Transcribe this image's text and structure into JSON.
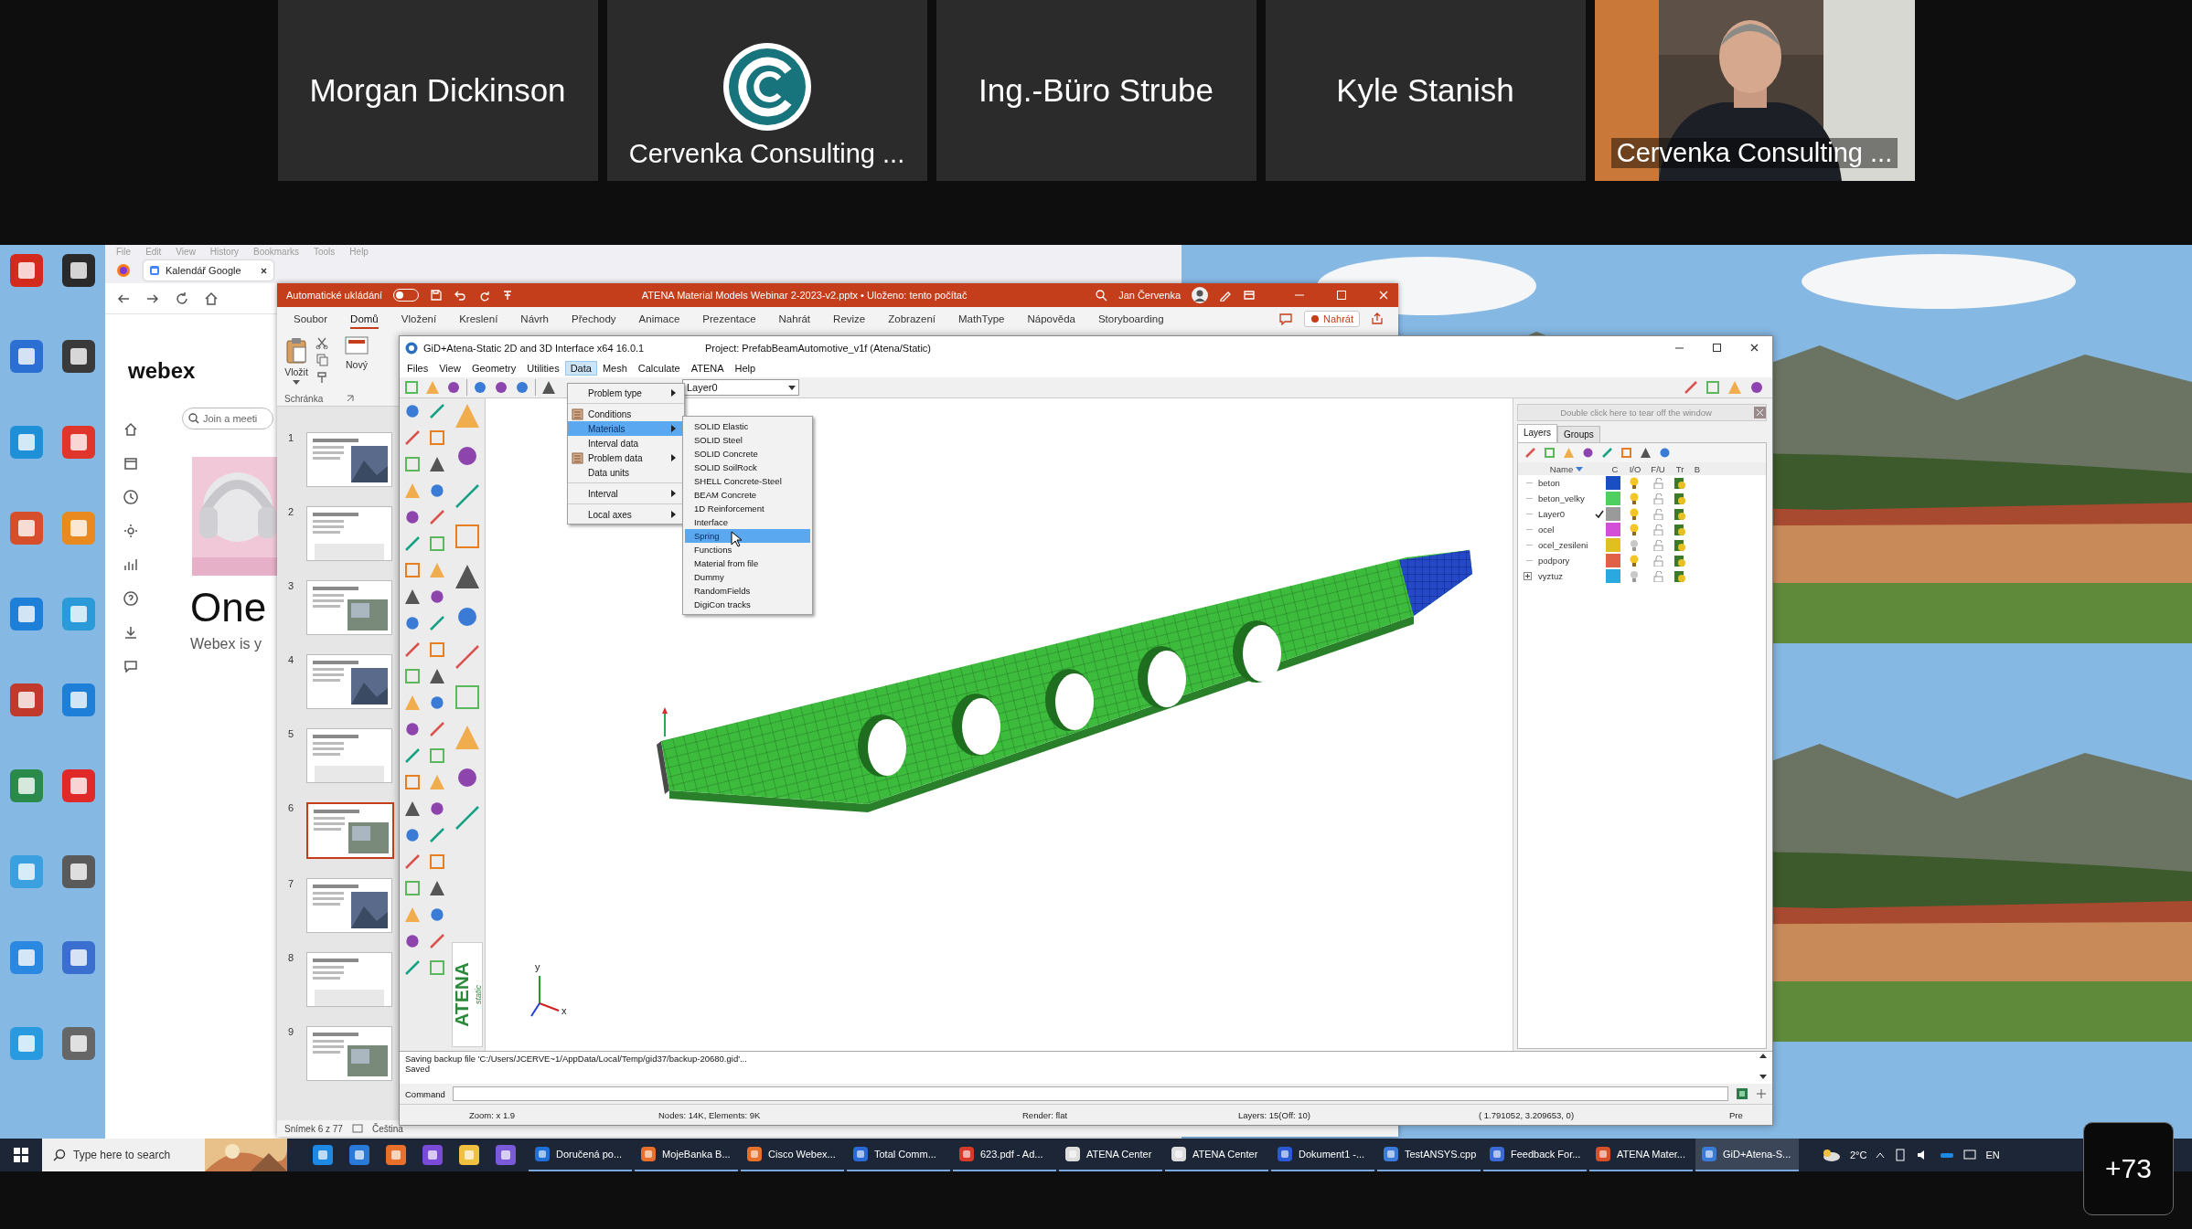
{
  "participants": [
    {
      "name": "Morgan Dickinson",
      "kind": "name"
    },
    {
      "name": "Cervenka Consulting ...",
      "kind": "logo"
    },
    {
      "name": "Ing.-Büro Strube",
      "kind": "name"
    },
    {
      "name": "Kyle Stanish",
      "kind": "name"
    },
    {
      "name": "Cervenka Consulting ...",
      "kind": "video"
    }
  ],
  "hidden_participants": "+73",
  "browser": {
    "menu": [
      "File",
      "Edit",
      "View",
      "History",
      "Bookmarks",
      "Tools",
      "Help"
    ],
    "tab": "Kalendář Google",
    "brand": "webex",
    "search": {
      "placeholder": "Join a meeti"
    },
    "headline": "One",
    "tagline": "Webex is y"
  },
  "powerpoint": {
    "autosave": {
      "label": "Automatické ukládání",
      "on": false
    },
    "title": "ATENA Material Models Webinar 2-2023-v2.pptx • Uloženo: tento počítač",
    "user": "Jan Červenka",
    "tabs": [
      {
        "label": "Soubor",
        "selected": false
      },
      {
        "label": "Domů",
        "selected": true
      },
      {
        "label": "Vložení",
        "selected": false
      },
      {
        "label": "Kreslení",
        "selected": false
      },
      {
        "label": "Návrh",
        "selected": false
      },
      {
        "label": "Přechody",
        "selected": false
      },
      {
        "label": "Animace",
        "selected": false
      },
      {
        "label": "Prezentace",
        "selected": false
      },
      {
        "label": "Nahrát",
        "selected": false
      },
      {
        "label": "Revize",
        "selected": false
      },
      {
        "label": "Zobrazení",
        "selected": false
      },
      {
        "label": "MathType",
        "selected": false
      },
      {
        "label": "Nápověda",
        "selected": false
      },
      {
        "label": "Storyboarding",
        "selected": false
      }
    ],
    "record": "Nahrát",
    "paste": "Vložit",
    "new_slide": "Nový",
    "clipboard_group": "Schránka",
    "slides": [
      {
        "number": "1",
        "selected": false
      },
      {
        "number": "2",
        "selected": false
      },
      {
        "number": "3",
        "selected": false
      },
      {
        "number": "4",
        "selected": false
      },
      {
        "number": "5",
        "selected": false
      },
      {
        "number": "6",
        "selected": true
      },
      {
        "number": "7",
        "selected": false
      },
      {
        "number": "8",
        "selected": false
      },
      {
        "number": "9",
        "selected": false
      }
    ],
    "status": "Snímek 6 z 77",
    "language": "Čeština"
  },
  "gid": {
    "title": "GiD+Atena-Static 2D and 3D Interface x64 16.0.1",
    "project": "Project: PrefabBeamAutomotive_v1f (Atena/Static)",
    "menu": [
      {
        "label": "Files",
        "selected": false
      },
      {
        "label": "View",
        "selected": false
      },
      {
        "label": "Geometry",
        "selected": false
      },
      {
        "label": "Utilities",
        "selected": false
      },
      {
        "label": "Data",
        "selected": true
      },
      {
        "label": "Mesh",
        "selected": false
      },
      {
        "label": "Calculate",
        "selected": false
      },
      {
        "label": "ATENA",
        "selected": false
      },
      {
        "label": "Help",
        "selected": false
      }
    ],
    "layer_field": "Layer0",
    "brand": "ATENA",
    "brand_sub": "static",
    "data_menu": [
      [
        {
          "label": "Problem type",
          "kind": "submenu",
          "icon": false,
          "selected": false
        }
      ],
      [
        {
          "label": "Conditions",
          "kind": "command",
          "icon": true,
          "selected": false
        },
        {
          "label": "Materials",
          "kind": "submenu",
          "icon": false,
          "selected": true
        },
        {
          "label": "Interval data",
          "kind": "command",
          "icon": false,
          "selected": false
        },
        {
          "label": "Problem data",
          "kind": "submenu",
          "icon": true,
          "selected": false
        },
        {
          "label": "Data units",
          "kind": "command",
          "icon": false,
          "selected": false
        }
      ],
      [
        {
          "label": "Interval",
          "kind": "submenu",
          "icon": false,
          "selected": false
        }
      ],
      [
        {
          "label": "Local axes",
          "kind": "submenu",
          "icon": false,
          "selected": false
        }
      ]
    ],
    "materials_menu": [
      {
        "label": "SOLID Elastic",
        "selected": false
      },
      {
        "label": "SOLID Steel",
        "selected": false
      },
      {
        "label": "SOLID Concrete",
        "selected": false
      },
      {
        "label": "SOLID SoilRock",
        "selected": false
      },
      {
        "label": "SHELL Concrete-Steel",
        "selected": false
      },
      {
        "label": "BEAM Concrete",
        "selected": false
      },
      {
        "label": "1D Reinforcement",
        "selected": false
      },
      {
        "label": "Interface",
        "selected": false
      },
      {
        "label": "Spring",
        "selected": true
      },
      {
        "label": "Functions",
        "selected": false
      },
      {
        "label": "Material from file",
        "selected": false
      },
      {
        "label": "Dummy",
        "selected": false
      },
      {
        "label": "RandomFields",
        "selected": false
      },
      {
        "label": "DigiCon tracks",
        "selected": false
      }
    ],
    "layers_panel": {
      "tear_hint": "Double click here to tear off the window",
      "tabs": [
        {
          "label": "Layers",
          "selected": true
        },
        {
          "label": "Groups",
          "selected": false
        }
      ],
      "columns": [
        "Name",
        "C",
        "I/O",
        "F/U",
        "Tr",
        "B"
      ],
      "layers": [
        {
          "name": "beton",
          "color": "#1a4fc4",
          "on": true,
          "current": false,
          "expandable": false
        },
        {
          "name": "beton_velky",
          "color": "#4fcf5f",
          "on": true,
          "current": false,
          "expandable": false
        },
        {
          "name": "Layer0",
          "color": "#9a9a9a",
          "on": true,
          "current": true,
          "expandable": false
        },
        {
          "name": "ocel",
          "color": "#d44fd8",
          "on": true,
          "current": false,
          "expandable": false
        },
        {
          "name": "ocel_zesileni",
          "color": "#e0c020",
          "on": false,
          "current": false,
          "expandable": false
        },
        {
          "name": "podpory",
          "color": "#e06048",
          "on": true,
          "current": false,
          "expandable": false
        },
        {
          "name": "vyztuz",
          "color": "#2aa8e0",
          "on": false,
          "current": false,
          "expandable": true
        }
      ]
    },
    "axes": [
      "x",
      "y"
    ],
    "log": [
      "Saving backup file 'C:/Users/JCERVE~1/AppData/Local/Temp/gid37/backup-20680.gid'...",
      "Saved"
    ],
    "command_label": "Command",
    "status": [
      "Zoom: x 1.9",
      "Nodes: 14K, Elements: 9K",
      "Render: flat",
      "Layers: 15(Off: 10)",
      "( 1.791052, 3.209653, 0)",
      "Pre"
    ]
  },
  "taskbar": {
    "search": {
      "placeholder": "Type here to search"
    },
    "apps": [
      {
        "label": "Doručená po...",
        "selected": false
      },
      {
        "label": "MojeBanka B...",
        "selected": false
      },
      {
        "label": "Cisco Webex...",
        "selected": false
      },
      {
        "label": "Total Comm...",
        "selected": false
      },
      {
        "label": "623.pdf - Ad...",
        "selected": false
      },
      {
        "label": "ATENA Center",
        "selected": false
      },
      {
        "label": "ATENA Center",
        "selected": false
      },
      {
        "label": "Dokument1 -...",
        "selected": false
      },
      {
        "label": "TestANSYS.cpp",
        "selected": false
      },
      {
        "label": "Feedback For...",
        "selected": false
      },
      {
        "label": "ATENA Mater...",
        "selected": false
      },
      {
        "label": "GiD+Atena-S...",
        "selected": true
      }
    ],
    "weather": "2°C",
    "language": "EN"
  }
}
